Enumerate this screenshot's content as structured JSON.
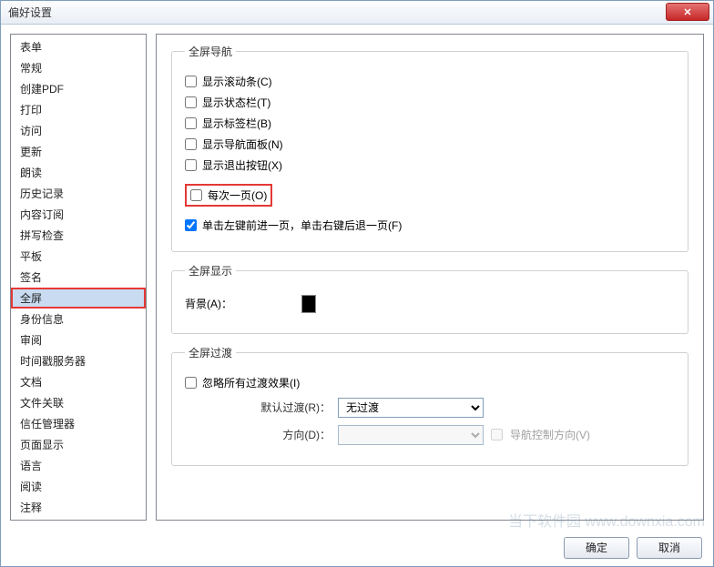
{
  "window": {
    "title": "偏好设置",
    "close_symbol": "✕"
  },
  "sidebar": {
    "items": [
      {
        "label": "表单"
      },
      {
        "label": "常规"
      },
      {
        "label": "创建PDF"
      },
      {
        "label": "打印"
      },
      {
        "label": "访问"
      },
      {
        "label": "更新"
      },
      {
        "label": "朗读"
      },
      {
        "label": "历史记录"
      },
      {
        "label": "内容订阅"
      },
      {
        "label": "拼写检查"
      },
      {
        "label": "平板"
      },
      {
        "label": "签名"
      },
      {
        "label": "全屏"
      },
      {
        "label": "身份信息"
      },
      {
        "label": "审阅"
      },
      {
        "label": "时间戳服务器"
      },
      {
        "label": "文档"
      },
      {
        "label": "文件关联"
      },
      {
        "label": "信任管理器"
      },
      {
        "label": "页面显示"
      },
      {
        "label": "语言"
      },
      {
        "label": "阅读"
      },
      {
        "label": "注释"
      }
    ]
  },
  "nav_group": {
    "legend": "全屏导航",
    "show_scrollbar": "显示滚动条(C)",
    "show_statusbar": "显示状态栏(T)",
    "show_tabbar": "显示标签栏(B)",
    "show_navpanel": "显示导航面板(N)",
    "show_exitbtn": "显示退出按钮(X)",
    "one_page": "每次一页(O)",
    "click_nav": "单击左键前进一页，单击右键后退一页(F)"
  },
  "display_group": {
    "legend": "全屏显示",
    "background_label": "背景(A)："
  },
  "transition_group": {
    "legend": "全屏过渡",
    "ignore_all": "忽略所有过渡效果(I)",
    "default_trans_label": "默认过渡(R)：",
    "default_trans_value": "无过渡",
    "direction_label": "方向(D)：",
    "nav_control": "导航控制方向(V)"
  },
  "footer": {
    "ok": "确定",
    "cancel": "取消"
  },
  "watermark": "当下软件园\nwww.downxia.com"
}
